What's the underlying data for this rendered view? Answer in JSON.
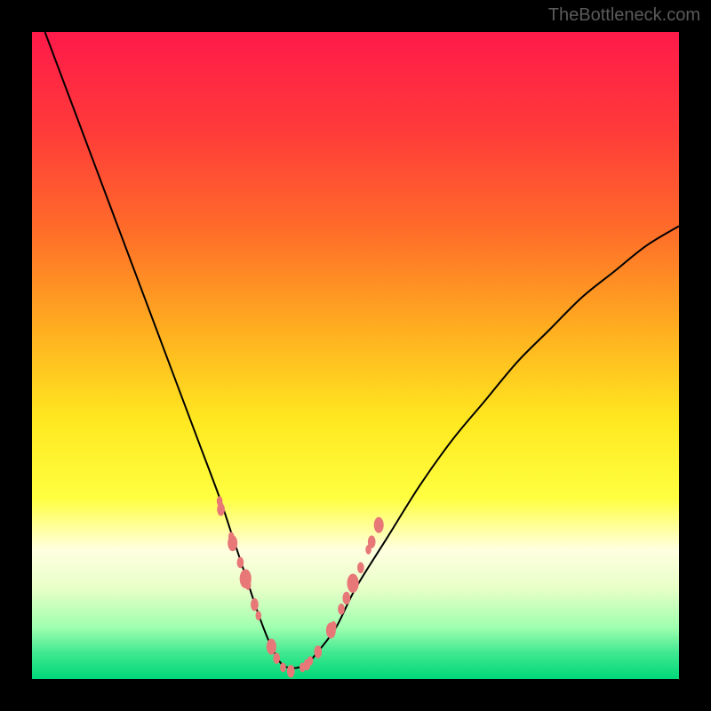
{
  "watermark": "TheBottleneck.com",
  "chart_data": {
    "type": "line",
    "title": "",
    "xlabel": "",
    "ylabel": "",
    "description": "Bottleneck V-curve on rainbow gradient background showing performance dip",
    "curve": {
      "x": [
        0.02,
        0.05,
        0.08,
        0.11,
        0.14,
        0.17,
        0.2,
        0.23,
        0.26,
        0.29,
        0.31,
        0.33,
        0.35,
        0.37,
        0.39,
        0.42,
        0.44,
        0.47,
        0.5,
        0.55,
        0.6,
        0.65,
        0.7,
        0.75,
        0.8,
        0.85,
        0.9,
        0.95,
        1.0
      ],
      "y": [
        1.0,
        0.92,
        0.84,
        0.76,
        0.68,
        0.6,
        0.52,
        0.44,
        0.36,
        0.28,
        0.22,
        0.16,
        0.1,
        0.05,
        0.02,
        0.02,
        0.04,
        0.08,
        0.14,
        0.22,
        0.3,
        0.37,
        0.43,
        0.49,
        0.54,
        0.59,
        0.63,
        0.67,
        0.7
      ]
    },
    "scatter_points": {
      "x": [
        0.29,
        0.292,
        0.308,
        0.31,
        0.322,
        0.33,
        0.334,
        0.344,
        0.35,
        0.37,
        0.378,
        0.388,
        0.4,
        0.418,
        0.425,
        0.43,
        0.442,
        0.462,
        0.466,
        0.478,
        0.486,
        0.496,
        0.508,
        0.52,
        0.525,
        0.536
      ],
      "y": [
        0.275,
        0.262,
        0.22,
        0.21,
        0.18,
        0.155,
        0.145,
        0.115,
        0.098,
        0.05,
        0.032,
        0.018,
        0.012,
        0.018,
        0.022,
        0.028,
        0.042,
        0.075,
        0.082,
        0.108,
        0.125,
        0.148,
        0.172,
        0.2,
        0.212,
        0.238
      ],
      "color": "#e87878",
      "size_variation": [
        6,
        8,
        6,
        10,
        7,
        12,
        6,
        8,
        6,
        10,
        7,
        6,
        8,
        6,
        7,
        6,
        8,
        10,
        6,
        7,
        8,
        12,
        7,
        6,
        8,
        10
      ]
    },
    "gradient_stops": [
      {
        "offset": 0.0,
        "color": "#ff1a4a"
      },
      {
        "offset": 0.15,
        "color": "#ff3a3a"
      },
      {
        "offset": 0.3,
        "color": "#ff6a2a"
      },
      {
        "offset": 0.45,
        "color": "#ffaa20"
      },
      {
        "offset": 0.6,
        "color": "#ffe820"
      },
      {
        "offset": 0.72,
        "color": "#ffff40"
      },
      {
        "offset": 0.8,
        "color": "#ffffe0"
      },
      {
        "offset": 0.86,
        "color": "#e8ffc8"
      },
      {
        "offset": 0.92,
        "color": "#a0ffb0"
      },
      {
        "offset": 0.96,
        "color": "#40e890"
      },
      {
        "offset": 1.0,
        "color": "#00d878"
      }
    ],
    "xlim": [
      0,
      1
    ],
    "ylim": [
      0,
      1
    ]
  }
}
